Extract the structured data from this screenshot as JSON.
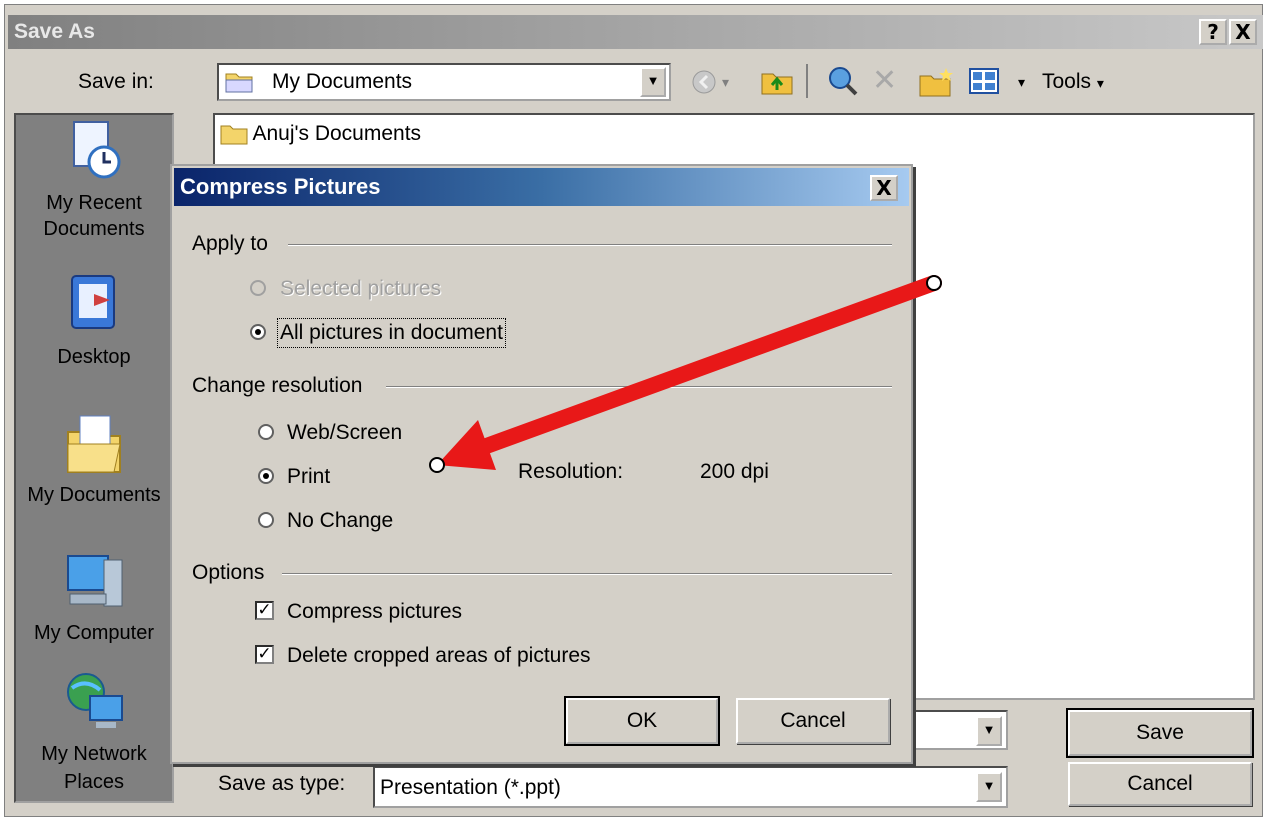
{
  "save_as": {
    "title": "Save As",
    "help_btn": "?",
    "close_btn": "X",
    "save_in_label": "Save in:",
    "save_in_value": "My Documents",
    "tools_label": "Tools",
    "places": [
      {
        "label": "My Recent Documents",
        "icon": "recent-documents-icon"
      },
      {
        "label": "Desktop",
        "icon": "desktop-icon"
      },
      {
        "label": "My Documents",
        "icon": "my-documents-icon"
      },
      {
        "label": "My Computer",
        "icon": "my-computer-icon"
      },
      {
        "label": "My Network Places",
        "icon": "network-places-icon"
      }
    ],
    "files": [
      "Anuj's Documents"
    ],
    "save_as_type_label": "Save as type:",
    "save_as_type_value": "Presentation (*.ppt)",
    "save_btn": "Save",
    "cancel_btn": "Cancel"
  },
  "compress": {
    "title": "Compress Pictures",
    "close_btn": "X",
    "apply_to_label": "Apply to",
    "apply_options": [
      {
        "label": "Selected pictures",
        "checked": false,
        "disabled": true
      },
      {
        "label": "All pictures in document",
        "checked": true,
        "disabled": false
      }
    ],
    "change_res_label": "Change resolution",
    "res_options": [
      {
        "label": "Web/Screen",
        "checked": false
      },
      {
        "label": "Print",
        "checked": true
      },
      {
        "label": "No Change",
        "checked": false
      }
    ],
    "resolution_label": "Resolution:",
    "resolution_value": "200 dpi",
    "options_label": "Options",
    "checkboxes": [
      {
        "label": "Compress pictures",
        "checked": true
      },
      {
        "label": "Delete cropped areas of pictures",
        "checked": true
      }
    ],
    "ok_btn": "OK",
    "cancel_btn": "Cancel"
  },
  "colors": {
    "arrow": "#e81818",
    "active_title": "#0a246a"
  }
}
